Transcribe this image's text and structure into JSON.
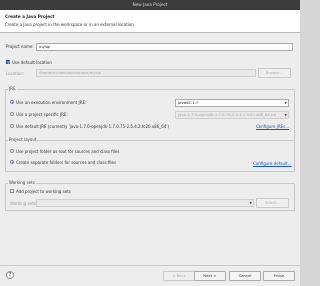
{
  "window": {
    "title": "New Java Project"
  },
  "header": {
    "title": "Create a Java Project",
    "description": "Create a Java project in the workspace or in an external location."
  },
  "project": {
    "name_label": "Project name:",
    "name_value": "mysql"
  },
  "location": {
    "use_default_label": "Use default location",
    "use_default_checked": true,
    "label": "Location:",
    "value": "/home/student/workspace/mysql",
    "browse_label": "Browse..."
  },
  "jre": {
    "group_title": "JRE",
    "option_env_label": "Use an execution environment JRE:",
    "option_env_value": "JavaSE-1.7",
    "option_specific_label": "Use a project specific JRE:",
    "option_specific_value": "java-1.7.0-openjdk-1.7.0.75-2.5.4.2.fc20.x86_64-jre",
    "option_default_label": "Use default JRE (currently 'java-1.7.0-openjdk-1.7.0.75-2.5.4.2.fc20.x86_64')",
    "configure_link": "Configure JREs...",
    "selected": "env"
  },
  "layout": {
    "group_title": "Project layout",
    "option_folder_label": "Use project folder as root for sources and class files",
    "option_separate_label": "Create separate folders for sources and class files",
    "configure_link": "Configure default...",
    "selected": "separate"
  },
  "working_sets": {
    "group_title": "Working sets",
    "add_label": "Add project to working sets",
    "add_checked": false,
    "label": "Working sets:",
    "value": "",
    "select_label": "Select..."
  },
  "footer": {
    "help_icon": "help-icon",
    "back_label": "< Back",
    "next_label": "Next >",
    "cancel_label": "Cancel",
    "finish_label": "Finish"
  }
}
